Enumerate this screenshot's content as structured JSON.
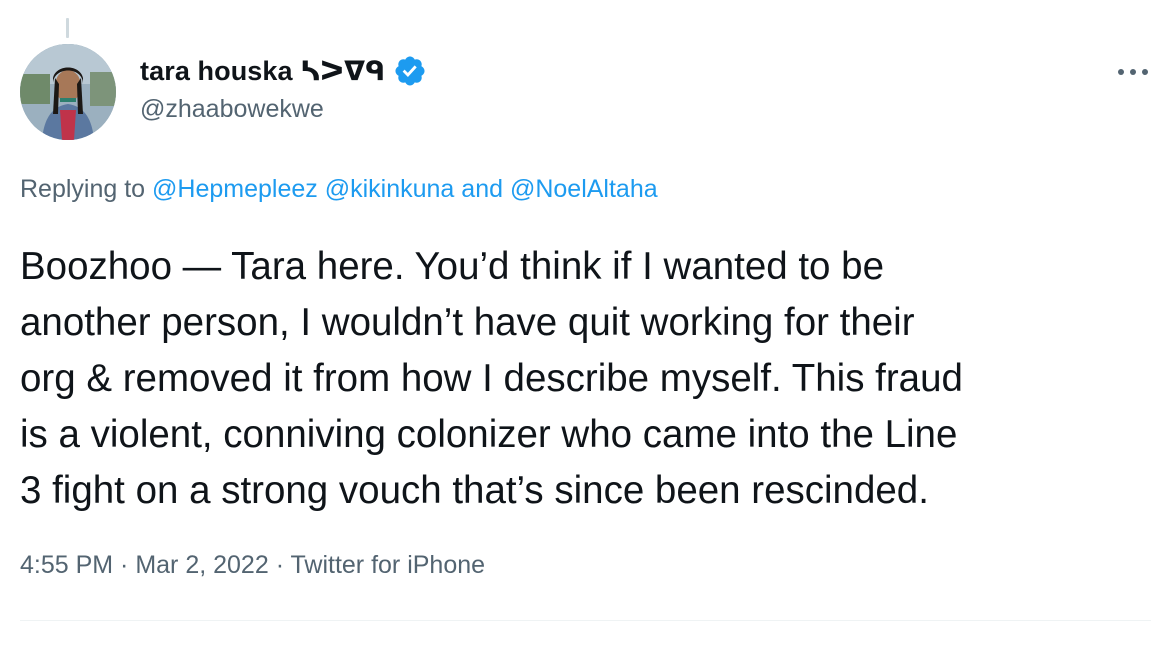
{
  "author": {
    "display_name": "tara houska ᓴᐳᐁᑫ",
    "handle": "@zhaabowekwe",
    "verified": true
  },
  "reply": {
    "prefix": "Replying to ",
    "mentions": [
      "@Hepmepleez",
      "@kikinkuna"
    ],
    "and_word": " and ",
    "last_mention": "@NoelAltaha"
  },
  "tweet": {
    "lines": [
      "Boozhoo — Tara here. You’d think if I wanted to be",
      "another person, I wouldn’t have quit working for their",
      "org & removed it from how I describe myself. This fraud",
      "is a violent, conniving colonizer who came into the Line",
      "3 fight on a strong vouch that’s since been rescinded."
    ]
  },
  "meta": {
    "time": "4:55 PM",
    "separator": " · ",
    "date": "Mar 2, 2022",
    "source": "Twitter for iPhone"
  },
  "colors": {
    "accent": "#1d9bf0",
    "secondary_text": "#536471",
    "primary_text": "#0f1419"
  },
  "icons": {
    "verified": "verified-badge-icon",
    "more": "more-options-icon"
  }
}
